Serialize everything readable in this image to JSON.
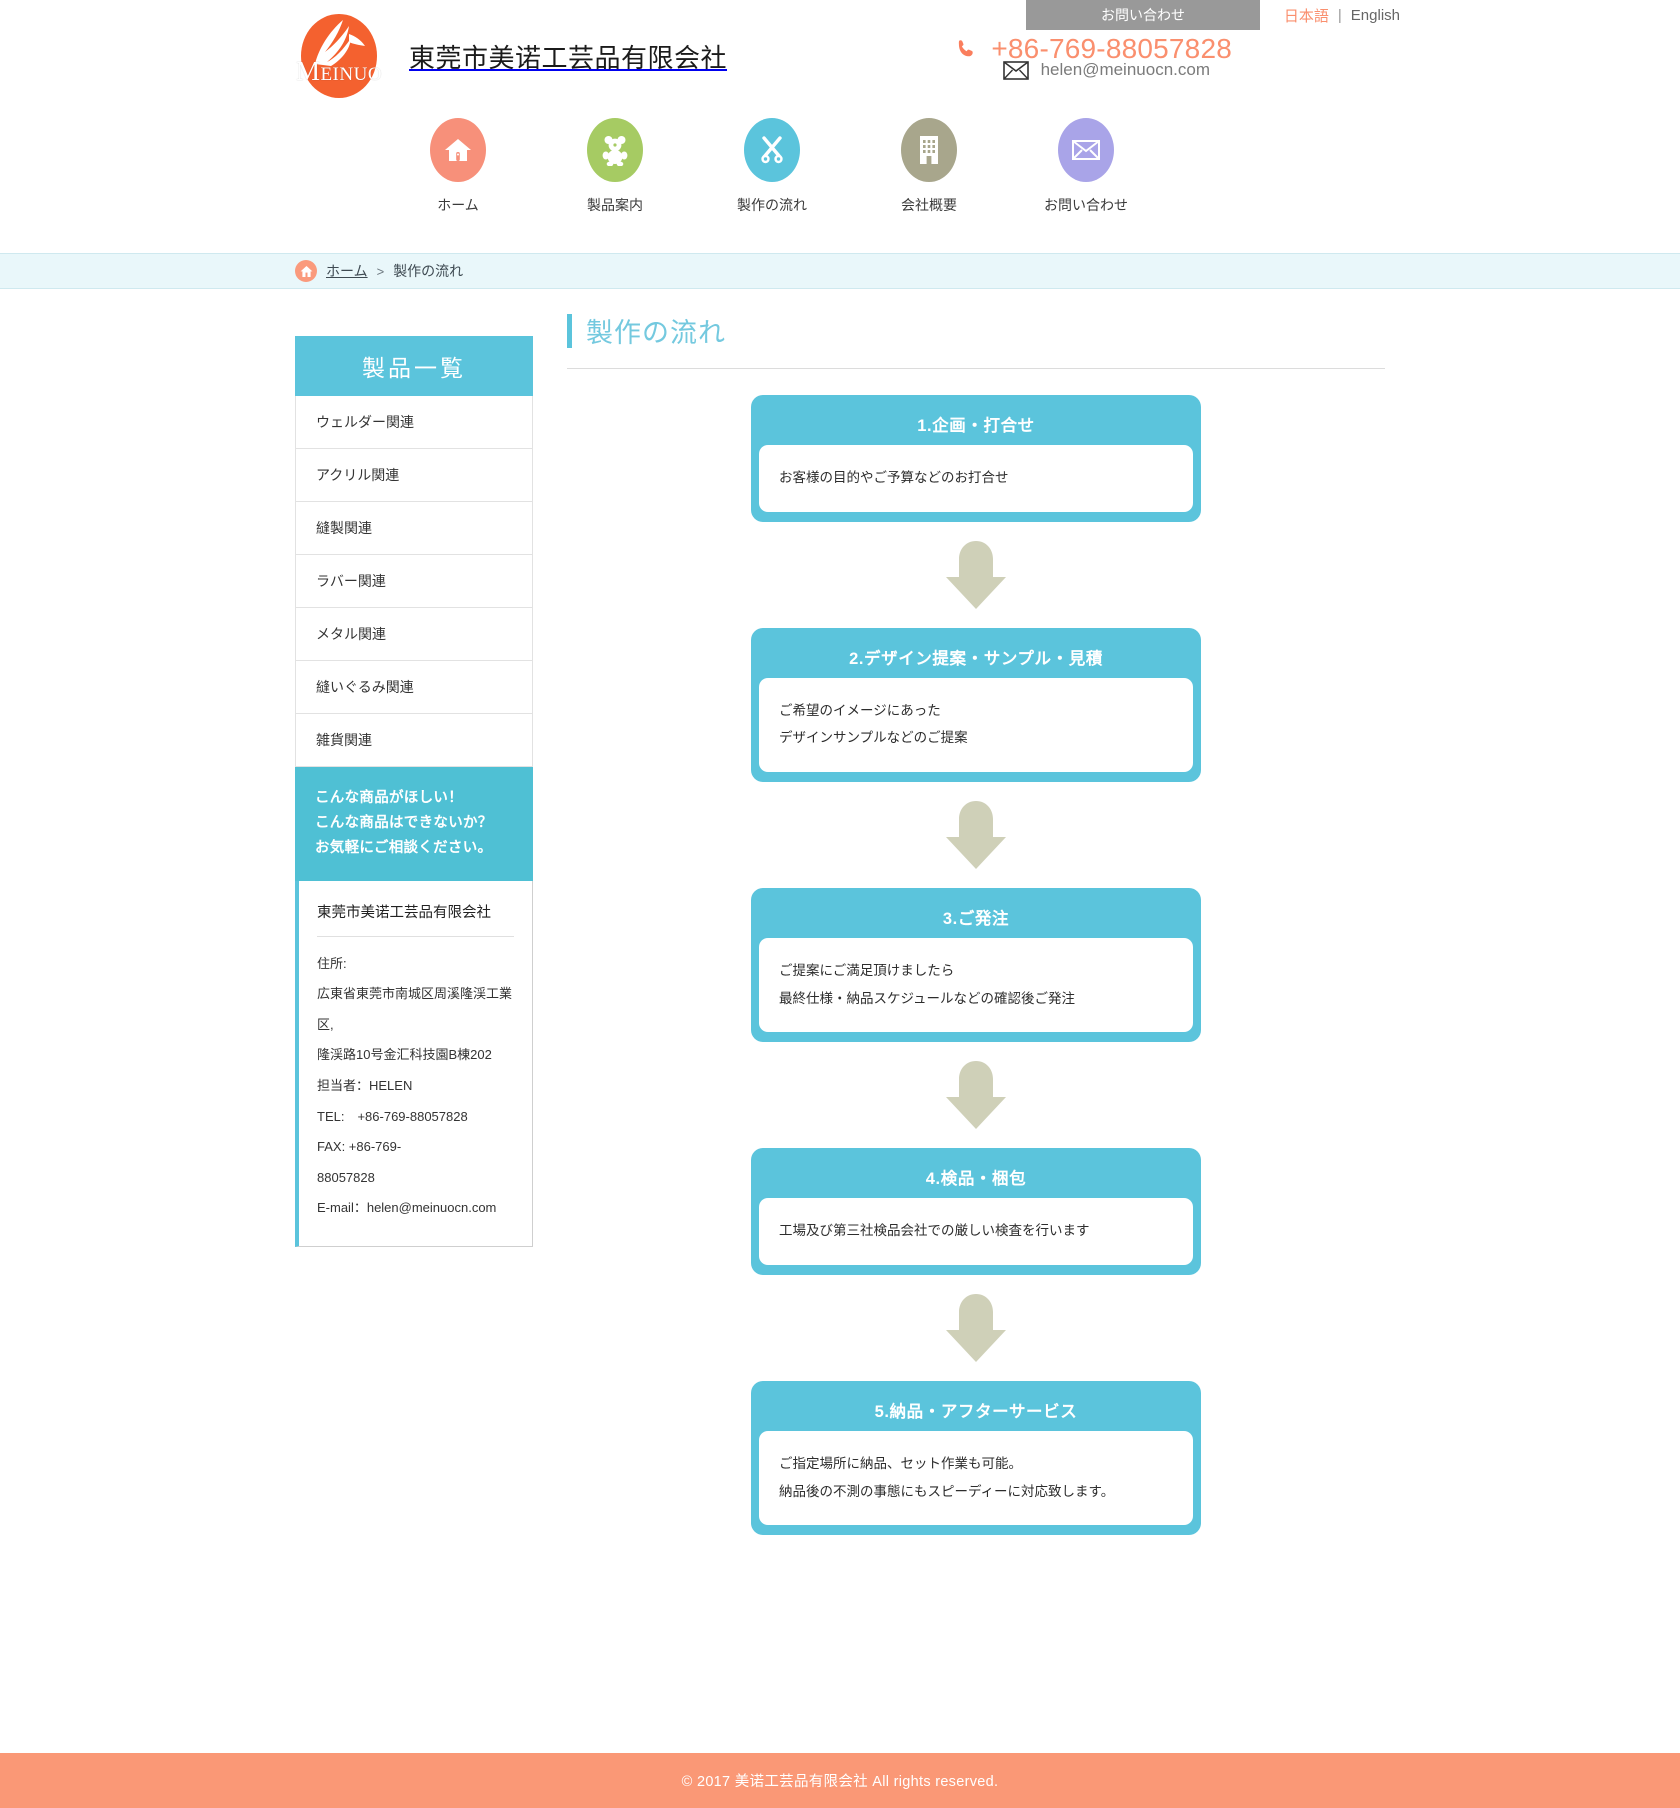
{
  "header": {
    "logo": {
      "brand_letter": "M",
      "brand_rest": "EINUO",
      "icon_name": "pegasus-bird-logo",
      "oval_color": "#f4612f"
    },
    "company_name": "東莞市美诺工芸品有限会社",
    "contact_button": "お問い合わせ",
    "language": {
      "japanese": "日本語",
      "separator": "|",
      "english": "English",
      "active_color": "#fa8f6e"
    },
    "phone": "+86-769-88057828",
    "email": "helen@meinuocn.com"
  },
  "nav": [
    {
      "label": "ホーム",
      "icon": "house-icon",
      "color": "#f7907a"
    },
    {
      "label": "製品案内",
      "icon": "teddy-bear-icon",
      "color": "#a6cb63"
    },
    {
      "label": "製作の流れ",
      "icon": "scissors-icon",
      "color": "#5bc4dc"
    },
    {
      "label": "会社概要",
      "icon": "office-building-icon",
      "color": "#a8a68c"
    },
    {
      "label": "お問い合わせ",
      "icon": "envelope-icon",
      "color": "#a9a4e8"
    }
  ],
  "breadcrumb": {
    "home_icon": "house-icon",
    "home": "ホーム",
    "separator": ">",
    "current": "製作の流れ"
  },
  "sidebar": {
    "heading": "製品一覧",
    "items": [
      {
        "label": "ウェルダー関連"
      },
      {
        "label": "アクリル関連"
      },
      {
        "label": "縫製関連"
      },
      {
        "label": "ラバー関連"
      },
      {
        "label": "メタル関連"
      },
      {
        "label": "縫いぐるみ関連"
      },
      {
        "label": "雑貨関連"
      }
    ],
    "cta": {
      "line1": "こんな商品がほしい！",
      "line2": "こんな商品はできないか？",
      "line3": "お気軽にご相談ください。",
      "bg_color": "#4fc0d4"
    },
    "info": {
      "company": "東莞市美诺工芸品有限会社",
      "lines": [
        "住所:",
        "広東省東莞市南城区周溪隆渓工業区,",
        "隆渓路10号金汇科技園B棟202",
        "担当者：HELEN",
        "TEL:　+86-769-88057828",
        "FAX: +86-769-",
        "88057828",
        "E-mail：helen@meinuocn.com"
      ]
    }
  },
  "main": {
    "title": "製作の流れ",
    "accent_color": "#5bc4dc",
    "arrow_color": "#cfd0b8",
    "steps": [
      {
        "heading": "1.企画・打合せ",
        "body": [
          "お客様の目的やご予算などのお打合せ"
        ]
      },
      {
        "heading": "2.デザイン提案・サンプル・見積",
        "body": [
          "ご希望のイメージにあった",
          "デザインサンプルなどのご提案"
        ]
      },
      {
        "heading": "3.ご発注",
        "body": [
          "ご提案にご満足頂けましたら",
          "最終仕様・納品スケジュールなどの確認後ご発注"
        ]
      },
      {
        "heading": "4.検品・梱包",
        "body": [
          "工場及び第三社検品会社での厳しい検査を行います"
        ]
      },
      {
        "heading": "5.納品・アフターサービス",
        "body": [
          "ご指定場所に納品、セット作業も可能。",
          "納品後の不測の事態にもスピーディーに対応致します。"
        ]
      }
    ]
  },
  "footer": {
    "text": "© 2017 美诺工芸品有限会社 All rights reserved.",
    "bg_color": "#fa9876"
  }
}
